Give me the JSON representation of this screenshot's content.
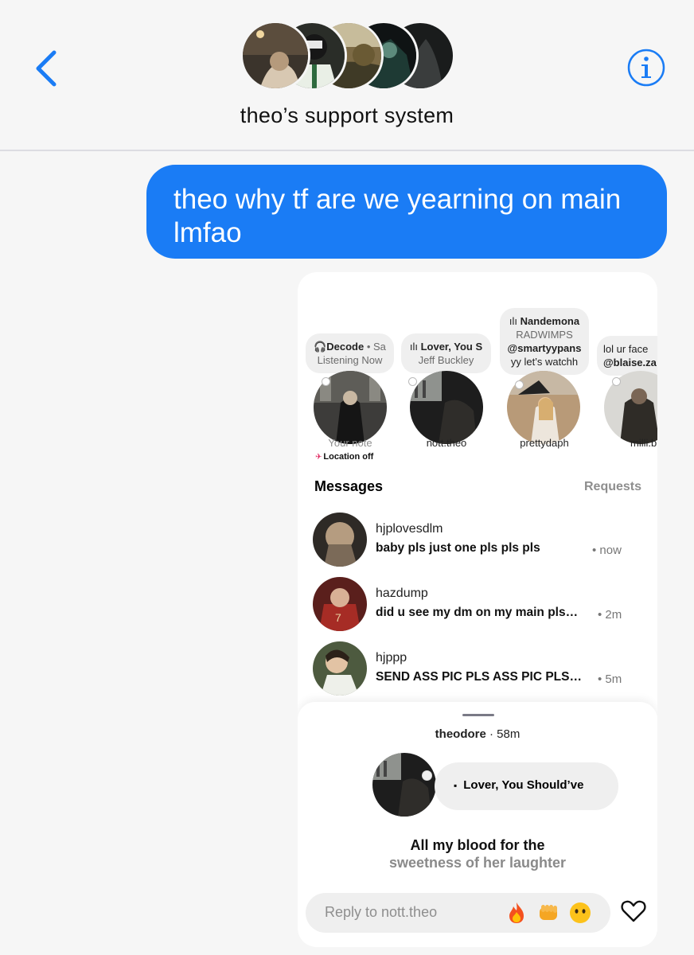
{
  "conversation": {
    "title": "theo’s support system",
    "back_icon": "chevron-left-icon",
    "info_icon": "info-icon",
    "accent_color": "#1a7cf5",
    "group_avatars": 5
  },
  "sent_message": {
    "text": "theo why tf are we yearning on main lmfao"
  },
  "instagram": {
    "notes": [
      {
        "user": "Your note",
        "song": "Decode",
        "artist": "Sa",
        "status": "Listening Now",
        "location": "Location off"
      },
      {
        "user": "nott.theo",
        "song": "Lover, You S",
        "artist": "Jeff Buckley"
      },
      {
        "user": "prettydaph",
        "song": "Nandemona",
        "artist": "RADWIMPS",
        "handle": "@smartyypans",
        "text": "yy let’s watchh"
      },
      {
        "user": "milli.b",
        "text": "lol ur face",
        "handle": "@blaise.za"
      }
    ],
    "messages_title": "Messages",
    "requests_label": "Requests",
    "threads": [
      {
        "name": "hjplovesdlm",
        "message": "baby pls just one pls pls pls",
        "time": "• now"
      },
      {
        "name": "hazdump",
        "message": "did u see my dm on my main pls…",
        "time": "• 2m"
      },
      {
        "name": "hjppp",
        "message": "SEND ASS PIC PLS ASS PIC PLS…",
        "time": "• 5m"
      }
    ],
    "note_sheet": {
      "user": "theodore",
      "time": "· 58m",
      "song": "Lover, You Should’ve",
      "lyric_line1": "All my blood for the",
      "lyric_line2": "sweetness of her laughter",
      "reply_placeholder": "Reply to nott.theo",
      "reactions": [
        "fire-emoji",
        "fist-emoji",
        "no-mouth-emoji"
      ],
      "like_icon": "heart-icon"
    }
  }
}
